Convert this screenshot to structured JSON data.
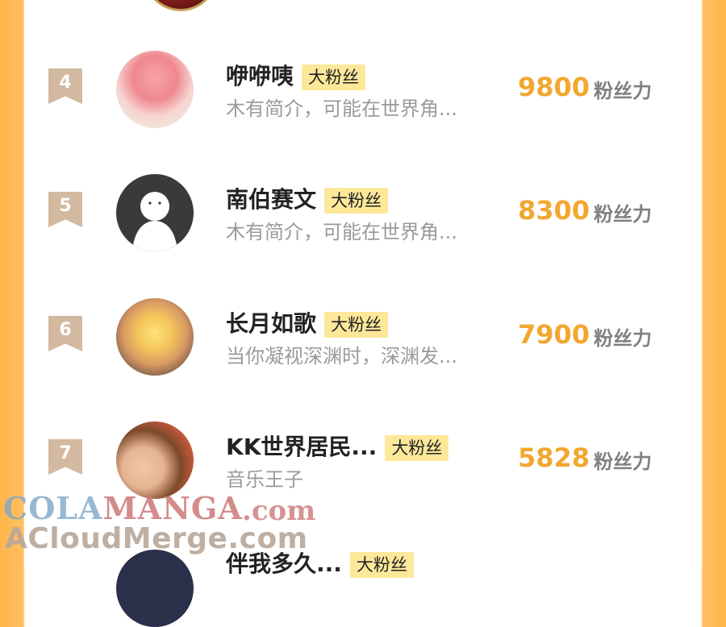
{
  "rows": [
    {
      "rank": "4",
      "name": "咿咿咦",
      "badge": "大粉丝",
      "bio": "木有简介，可能在世界角...",
      "score": "9800",
      "unit": "粉丝力"
    },
    {
      "rank": "5",
      "name": "南伯赛文",
      "badge": "大粉丝",
      "bio": "木有简介，可能在世界角...",
      "score": "8300",
      "unit": "粉丝力"
    },
    {
      "rank": "6",
      "name": "长月如歌",
      "badge": "大粉丝",
      "bio": "当你凝视深渊时，深渊发...",
      "score": "7900",
      "unit": "粉丝力"
    },
    {
      "rank": "7",
      "name": "KK世界居民...",
      "badge": "大粉丝",
      "bio": "音乐王子",
      "score": "5828",
      "unit": "粉丝力"
    }
  ],
  "partial_row": {
    "name": "伴我多久...",
    "badge": "大粉丝"
  },
  "watermark": {
    "part1": "COLA",
    "part2": "MANGA",
    "domain": ".com",
    "line2": "ACloudMerge.com"
  },
  "colors": {
    "score": "#f2a730",
    "badge_bg": "#fde89a",
    "border": "#ffb54a"
  }
}
